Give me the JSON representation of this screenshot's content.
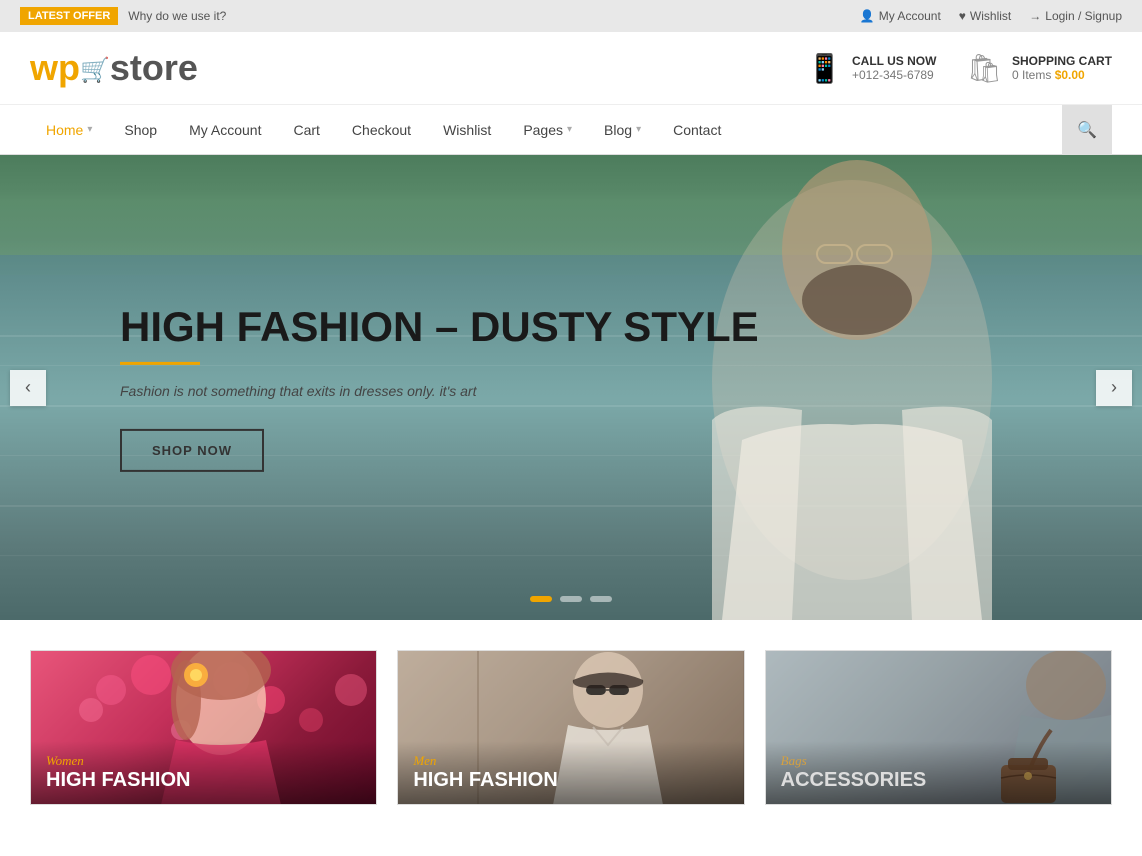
{
  "topbar": {
    "badge": "LATEST OFFER",
    "tagline": "Why do we use it?",
    "my_account": "My Account",
    "wishlist": "Wishlist",
    "login": "Login / Signup"
  },
  "header": {
    "logo_wp": "wp",
    "logo_store": "store",
    "call_label": "CALL US NOW",
    "call_number": "+012-345-6789",
    "cart_label": "SHOPPING CART",
    "cart_items": "0 Items",
    "cart_price": "$0.00"
  },
  "nav": {
    "items": [
      {
        "label": "Home",
        "active": true,
        "has_arrow": true
      },
      {
        "label": "Shop",
        "active": false,
        "has_arrow": false
      },
      {
        "label": "My Account",
        "active": false,
        "has_arrow": false
      },
      {
        "label": "Cart",
        "active": false,
        "has_arrow": false
      },
      {
        "label": "Checkout",
        "active": false,
        "has_arrow": false
      },
      {
        "label": "Wishlist",
        "active": false,
        "has_arrow": false
      },
      {
        "label": "Pages",
        "active": false,
        "has_arrow": true
      },
      {
        "label": "Blog",
        "active": false,
        "has_arrow": true
      },
      {
        "label": "Contact",
        "active": false,
        "has_arrow": false
      }
    ]
  },
  "hero": {
    "title": "HIGH FASHION – DUSTY STYLE",
    "subtitle": "Fashion is not something that exits in  dresses only. it's art",
    "cta": "SHOP NOW",
    "dots": [
      {
        "active": true
      },
      {
        "active": false
      },
      {
        "active": false
      }
    ]
  },
  "categories": [
    {
      "sub_label": "Women",
      "label": "High Fashion",
      "theme": "women"
    },
    {
      "sub_label": "Men",
      "label": "High Fashion",
      "theme": "men"
    },
    {
      "sub_label": "Bags",
      "label": "ACCESSORIES",
      "theme": "bags"
    }
  ],
  "icons": {
    "user": "👤",
    "heart": "♥",
    "login_arrow": "→",
    "phone": "📱",
    "briefcase": "🛍",
    "search": "🔍",
    "arrow_left": "‹",
    "arrow_right": "›"
  }
}
